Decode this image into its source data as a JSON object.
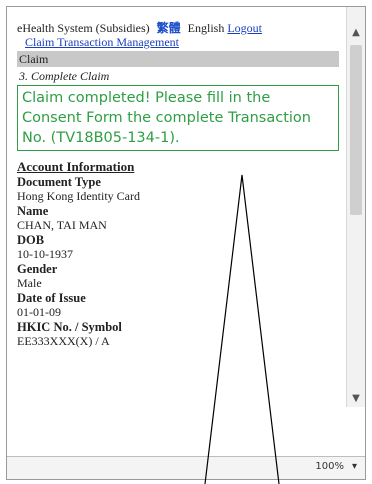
{
  "header": {
    "system_name": "eHealth System (Subsidies)",
    "chinese_label": "繁體",
    "english_label": "English",
    "logout_label": "Logout"
  },
  "nav": {
    "claim_transaction_link": "Claim Transaction Management"
  },
  "section": {
    "title": "Claim",
    "step": "3. Complete Claim"
  },
  "message": {
    "text": "Claim completed! Please fill in the Consent Form the complete Transaction No. (TV18B05-134-1).",
    "color": "#2f9e44"
  },
  "account": {
    "header": "Account Information",
    "fields": [
      {
        "label": "Document Type",
        "value": "Hong Kong Identity Card"
      },
      {
        "label": "Name",
        "value": "CHAN, TAI MAN"
      },
      {
        "label": "DOB",
        "value": "10-10-1937"
      },
      {
        "label": "Gender",
        "value": "Male"
      },
      {
        "label": "Date of Issue",
        "value": "01-01-09"
      },
      {
        "label": "HKIC No. / Symbol",
        "value": "EE333XXX(X) / A"
      }
    ]
  },
  "status_bar": {
    "zoom": "100%"
  }
}
